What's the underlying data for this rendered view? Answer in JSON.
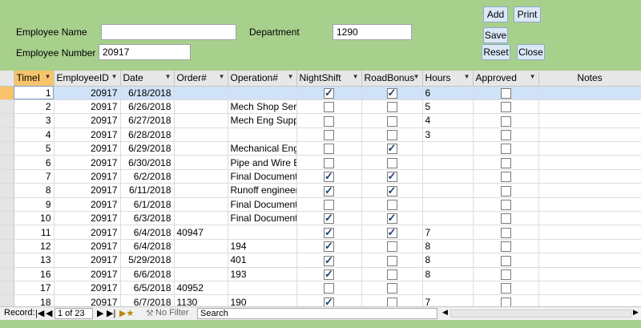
{
  "form": {
    "employee_name_label": "Employee Name",
    "employee_name_value": "",
    "department_label": "Department",
    "department_value": "1290",
    "employee_number_label": "Employee Number",
    "employee_number_value": "20917"
  },
  "buttons": {
    "add": "Add",
    "print": "Print",
    "save": "Save",
    "reset": "Reset",
    "close": "Close"
  },
  "grid": {
    "columns": [
      "TimeI",
      "EmployeeID",
      "Date",
      "Order#",
      "Operation#",
      "NightShift",
      "RoadBonus",
      "Hours",
      "Approved",
      "Notes"
    ],
    "rows": [
      {
        "timei": "1",
        "employee_id": "20917",
        "date": "6/18/2018",
        "order": "",
        "operation": "",
        "night": true,
        "road": true,
        "hours": "6",
        "approved": false
      },
      {
        "timei": "2",
        "employee_id": "20917",
        "date": "6/26/2018",
        "order": "",
        "operation": "Mech Shop Serv",
        "night": false,
        "road": false,
        "hours": "5",
        "approved": false
      },
      {
        "timei": "3",
        "employee_id": "20917",
        "date": "6/27/2018",
        "order": "",
        "operation": "Mech Eng Suppo",
        "night": false,
        "road": false,
        "hours": "4",
        "approved": false
      },
      {
        "timei": "4",
        "employee_id": "20917",
        "date": "6/28/2018",
        "order": "",
        "operation": "",
        "night": false,
        "road": false,
        "hours": "3",
        "approved": false
      },
      {
        "timei": "5",
        "employee_id": "20917",
        "date": "6/29/2018",
        "order": "",
        "operation": "Mechanical Eng",
        "night": false,
        "road": true,
        "hours": "",
        "approved": false
      },
      {
        "timei": "6",
        "employee_id": "20917",
        "date": "6/30/2018",
        "order": "",
        "operation": "Pipe and Wire E",
        "night": false,
        "road": false,
        "hours": "",
        "approved": false
      },
      {
        "timei": "7",
        "employee_id": "20917",
        "date": "6/2/2018",
        "order": "",
        "operation": "Final Document",
        "night": true,
        "road": true,
        "hours": "",
        "approved": false
      },
      {
        "timei": "8",
        "employee_id": "20917",
        "date": "6/11/2018",
        "order": "",
        "operation": "Runoff engineer",
        "night": true,
        "road": true,
        "hours": "",
        "approved": false
      },
      {
        "timei": "9",
        "employee_id": "20917",
        "date": "6/1/2018",
        "order": "",
        "operation": "Final Document",
        "night": false,
        "road": false,
        "hours": "",
        "approved": false
      },
      {
        "timei": "10",
        "employee_id": "20917",
        "date": "6/3/2018",
        "order": "",
        "operation": "Final Document",
        "night": true,
        "road": true,
        "hours": "",
        "approved": false
      },
      {
        "timei": "11",
        "employee_id": "20917",
        "date": "6/4/2018",
        "order": "40947",
        "operation": "",
        "night": true,
        "road": true,
        "hours": "7",
        "approved": false
      },
      {
        "timei": "12",
        "employee_id": "20917",
        "date": "6/4/2018",
        "order": "",
        "operation": "194",
        "night": true,
        "road": false,
        "hours": "8",
        "approved": false
      },
      {
        "timei": "13",
        "employee_id": "20917",
        "date": "5/29/2018",
        "order": "",
        "operation": "401",
        "night": true,
        "road": false,
        "hours": "8",
        "approved": false
      },
      {
        "timei": "16",
        "employee_id": "20917",
        "date": "6/6/2018",
        "order": "",
        "operation": "193",
        "night": true,
        "road": false,
        "hours": "8",
        "approved": false
      },
      {
        "timei": "17",
        "employee_id": "20917",
        "date": "6/5/2018",
        "order": "40952",
        "operation": "",
        "night": false,
        "road": false,
        "hours": "",
        "approved": false
      },
      {
        "timei": "18",
        "employee_id": "20917",
        "date": "6/7/2018",
        "order": "1130",
        "operation": "190",
        "night": true,
        "road": false,
        "hours": "7",
        "approved": false
      }
    ]
  },
  "navbar": {
    "record_label": "Record:",
    "record_position": "1 of 23",
    "filter_label": "No Filter",
    "search_placeholder": "Search"
  },
  "colors": {
    "form_bg": "#a8d08d",
    "selected_row": "#cfe2f7",
    "selector_active": "#f7c46c"
  }
}
